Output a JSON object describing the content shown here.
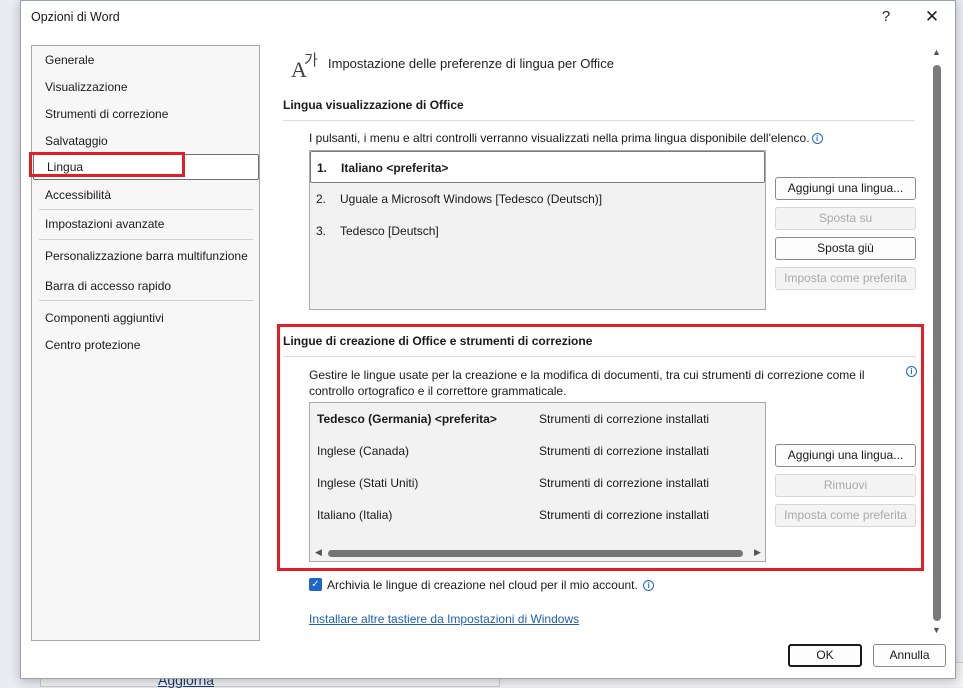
{
  "window": {
    "title": "Opzioni di Word",
    "help_label": "?",
    "close_label": "✕"
  },
  "background": {
    "partial_text": "Aggiorna"
  },
  "sidebar": {
    "items": [
      {
        "label": "Generale"
      },
      {
        "label": "Visualizzazione"
      },
      {
        "label": "Strumenti di correzione"
      },
      {
        "label": "Salvataggio"
      },
      {
        "label": "Lingua",
        "selected": true
      },
      {
        "label": "Accessibilità"
      },
      {
        "label": "Impostazioni avanzate"
      },
      {
        "label": "Personalizzazione barra multifunzione"
      },
      {
        "label": "Barra di accesso rapido"
      },
      {
        "label": "Componenti aggiuntivi"
      },
      {
        "label": "Centro protezione"
      }
    ]
  },
  "main": {
    "header_icon_a": "A",
    "header_icon_k": "가",
    "header_title": "Impostazione delle preferenze di lingua per Office",
    "display_section": {
      "title": "Lingua visualizzazione di Office",
      "description": "I pulsanti, i menu e altri controlli verranno visualizzati nella prima lingua disponibile dell'elenco.",
      "languages": [
        {
          "num": "1.",
          "label": "Italiano <preferita>",
          "selected": true
        },
        {
          "num": "2.",
          "label": "Uguale a Microsoft Windows [Tedesco (Deutsch)]"
        },
        {
          "num": "3.",
          "label": "Tedesco [Deutsch]"
        }
      ],
      "buttons": {
        "add": "Aggiungi una lingua...",
        "move_up": "Sposta su",
        "move_down": "Sposta giù",
        "set_preferred": "Imposta come preferita"
      }
    },
    "authoring_section": {
      "title": "Lingue di creazione di Office e strumenti di correzione",
      "description": "Gestire le lingue usate per la creazione e la modifica di documenti, tra cui strumenti di correzione come il controllo ortografico e il correttore grammaticale.",
      "languages": [
        {
          "label": "Tedesco (Germania) <preferita>",
          "status": "Strumenti di correzione installati",
          "bold": true
        },
        {
          "label": "Inglese (Canada)",
          "status": "Strumenti di correzione installati"
        },
        {
          "label": "Inglese (Stati Uniti)",
          "status": "Strumenti di correzione installati"
        },
        {
          "label": "Italiano (Italia)",
          "status": "Strumenti di correzione installati"
        }
      ],
      "buttons": {
        "add": "Aggiungi una lingua...",
        "remove": "Rimuovi",
        "set_preferred": "Imposta come preferita"
      }
    },
    "cloud_checkbox": {
      "label": "Archivia le lingue di creazione nel cloud per il mio account.",
      "checked": true
    },
    "keyboards_link": "Installare altre tastiere da Impostazioni di Windows"
  },
  "footer": {
    "ok": "OK",
    "cancel": "Annulla"
  },
  "colors": {
    "highlight": "#e01f27",
    "accent": "#1e66c8"
  }
}
